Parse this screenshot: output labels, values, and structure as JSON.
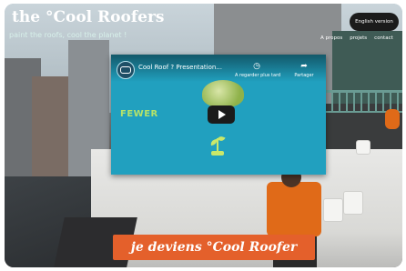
{
  "header": {
    "logo": "the °Cool Roofers",
    "tagline": "paint the roofs, cool the planet !",
    "language_button": "English version",
    "nav": [
      "A propos",
      "projets",
      "contact"
    ]
  },
  "video": {
    "title": "Cool Roof ? Presentation...",
    "watch_later_label": "A regarder plus tard",
    "share_label": "Partager",
    "overlay_text": "FEWER",
    "icons": {
      "channel": "channel-logo-icon",
      "watch_later": "clock-icon",
      "share": "share-arrow-icon",
      "play": "play-icon"
    }
  },
  "cta": {
    "label": "je deviens °Cool Roofer"
  },
  "colors": {
    "cta_background": "#e4602b",
    "video_background": "#21a0bf",
    "tagline": "#d7f0ea"
  }
}
